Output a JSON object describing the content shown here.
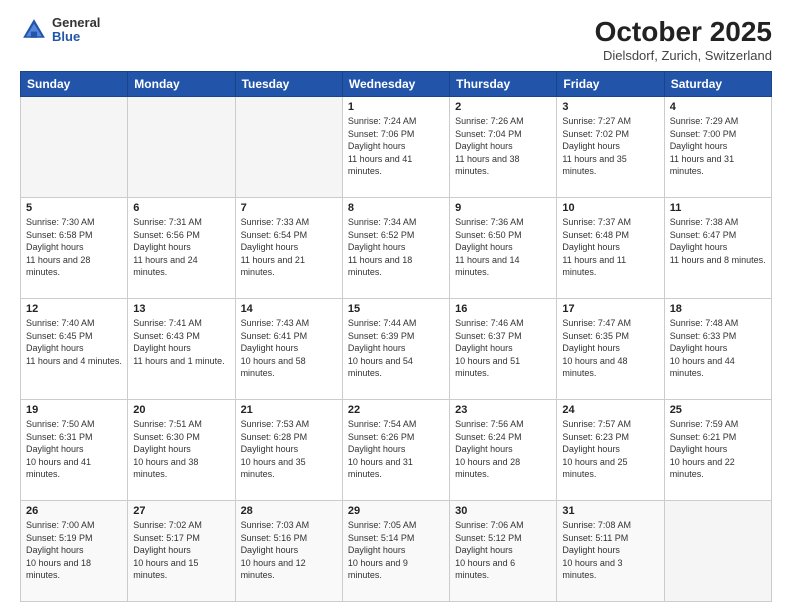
{
  "header": {
    "logo": {
      "general": "General",
      "blue": "Blue"
    },
    "title": "October 2025",
    "location": "Dielsdorf, Zurich, Switzerland"
  },
  "weekdays": [
    "Sunday",
    "Monday",
    "Tuesday",
    "Wednesday",
    "Thursday",
    "Friday",
    "Saturday"
  ],
  "weeks": [
    [
      {
        "day": "",
        "empty": true
      },
      {
        "day": "",
        "empty": true
      },
      {
        "day": "",
        "empty": true
      },
      {
        "day": "1",
        "sunrise": "7:24 AM",
        "sunset": "7:06 PM",
        "daylight": "11 hours and 41 minutes."
      },
      {
        "day": "2",
        "sunrise": "7:26 AM",
        "sunset": "7:04 PM",
        "daylight": "11 hours and 38 minutes."
      },
      {
        "day": "3",
        "sunrise": "7:27 AM",
        "sunset": "7:02 PM",
        "daylight": "11 hours and 35 minutes."
      },
      {
        "day": "4",
        "sunrise": "7:29 AM",
        "sunset": "7:00 PM",
        "daylight": "11 hours and 31 minutes."
      }
    ],
    [
      {
        "day": "5",
        "sunrise": "7:30 AM",
        "sunset": "6:58 PM",
        "daylight": "11 hours and 28 minutes."
      },
      {
        "day": "6",
        "sunrise": "7:31 AM",
        "sunset": "6:56 PM",
        "daylight": "11 hours and 24 minutes."
      },
      {
        "day": "7",
        "sunrise": "7:33 AM",
        "sunset": "6:54 PM",
        "daylight": "11 hours and 21 minutes."
      },
      {
        "day": "8",
        "sunrise": "7:34 AM",
        "sunset": "6:52 PM",
        "daylight": "11 hours and 18 minutes."
      },
      {
        "day": "9",
        "sunrise": "7:36 AM",
        "sunset": "6:50 PM",
        "daylight": "11 hours and 14 minutes."
      },
      {
        "day": "10",
        "sunrise": "7:37 AM",
        "sunset": "6:48 PM",
        "daylight": "11 hours and 11 minutes."
      },
      {
        "day": "11",
        "sunrise": "7:38 AM",
        "sunset": "6:47 PM",
        "daylight": "11 hours and 8 minutes."
      }
    ],
    [
      {
        "day": "12",
        "sunrise": "7:40 AM",
        "sunset": "6:45 PM",
        "daylight": "11 hours and 4 minutes."
      },
      {
        "day": "13",
        "sunrise": "7:41 AM",
        "sunset": "6:43 PM",
        "daylight": "11 hours and 1 minute."
      },
      {
        "day": "14",
        "sunrise": "7:43 AM",
        "sunset": "6:41 PM",
        "daylight": "10 hours and 58 minutes."
      },
      {
        "day": "15",
        "sunrise": "7:44 AM",
        "sunset": "6:39 PM",
        "daylight": "10 hours and 54 minutes."
      },
      {
        "day": "16",
        "sunrise": "7:46 AM",
        "sunset": "6:37 PM",
        "daylight": "10 hours and 51 minutes."
      },
      {
        "day": "17",
        "sunrise": "7:47 AM",
        "sunset": "6:35 PM",
        "daylight": "10 hours and 48 minutes."
      },
      {
        "day": "18",
        "sunrise": "7:48 AM",
        "sunset": "6:33 PM",
        "daylight": "10 hours and 44 minutes."
      }
    ],
    [
      {
        "day": "19",
        "sunrise": "7:50 AM",
        "sunset": "6:31 PM",
        "daylight": "10 hours and 41 minutes."
      },
      {
        "day": "20",
        "sunrise": "7:51 AM",
        "sunset": "6:30 PM",
        "daylight": "10 hours and 38 minutes."
      },
      {
        "day": "21",
        "sunrise": "7:53 AM",
        "sunset": "6:28 PM",
        "daylight": "10 hours and 35 minutes."
      },
      {
        "day": "22",
        "sunrise": "7:54 AM",
        "sunset": "6:26 PM",
        "daylight": "10 hours and 31 minutes."
      },
      {
        "day": "23",
        "sunrise": "7:56 AM",
        "sunset": "6:24 PM",
        "daylight": "10 hours and 28 minutes."
      },
      {
        "day": "24",
        "sunrise": "7:57 AM",
        "sunset": "6:23 PM",
        "daylight": "10 hours and 25 minutes."
      },
      {
        "day": "25",
        "sunrise": "7:59 AM",
        "sunset": "6:21 PM",
        "daylight": "10 hours and 22 minutes."
      }
    ],
    [
      {
        "day": "26",
        "sunrise": "7:00 AM",
        "sunset": "5:19 PM",
        "daylight": "10 hours and 18 minutes."
      },
      {
        "day": "27",
        "sunrise": "7:02 AM",
        "sunset": "5:17 PM",
        "daylight": "10 hours and 15 minutes."
      },
      {
        "day": "28",
        "sunrise": "7:03 AM",
        "sunset": "5:16 PM",
        "daylight": "10 hours and 12 minutes."
      },
      {
        "day": "29",
        "sunrise": "7:05 AM",
        "sunset": "5:14 PM",
        "daylight": "10 hours and 9 minutes."
      },
      {
        "day": "30",
        "sunrise": "7:06 AM",
        "sunset": "5:12 PM",
        "daylight": "10 hours and 6 minutes."
      },
      {
        "day": "31",
        "sunrise": "7:08 AM",
        "sunset": "5:11 PM",
        "daylight": "10 hours and 3 minutes."
      },
      {
        "day": "",
        "empty": true
      }
    ]
  ]
}
